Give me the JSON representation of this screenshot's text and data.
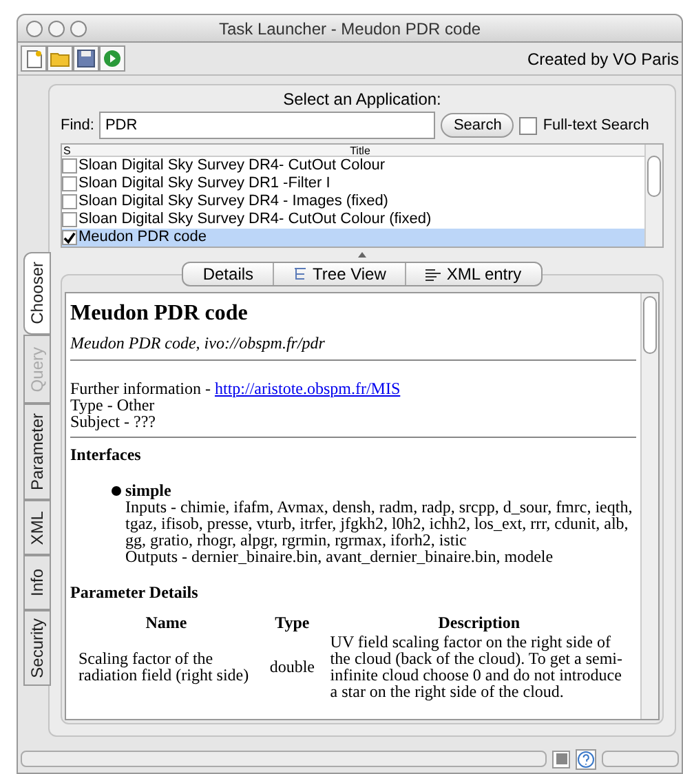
{
  "window": {
    "title": "Task Launcher - Meudon PDR code"
  },
  "credit": "Created by VO Paris",
  "chooser": {
    "heading": "Select an Application:",
    "find_label": "Find:",
    "find_value": "PDR",
    "search_button": "Search",
    "full_text": {
      "label": "Full-text Search",
      "checked": false
    }
  },
  "table": {
    "columns": [
      "S",
      "Title"
    ],
    "rows": [
      {
        "title": "Sloan Digital Sky Survey DR4- CutOut Colour",
        "checked": false,
        "selected": false
      },
      {
        "title": "Sloan Digital Sky Survey DR1 -Filter I",
        "checked": false,
        "selected": false
      },
      {
        "title": "Sloan Digital Sky Survey DR4 - Images (fixed)",
        "checked": false,
        "selected": false
      },
      {
        "title": "Sloan Digital Sky Survey DR4- CutOut Colour (fixed)",
        "checked": false,
        "selected": false
      },
      {
        "title": "Meudon PDR code",
        "checked": true,
        "selected": true
      }
    ]
  },
  "detail_tabs": [
    {
      "label": "Details",
      "kind": "plain"
    },
    {
      "label": "Tree View",
      "kind": "tree"
    },
    {
      "label": "XML entry",
      "kind": "xml"
    }
  ],
  "side_tabs": [
    {
      "label": "Chooser",
      "selected": true,
      "disabled": false
    },
    {
      "label": "Query",
      "selected": false,
      "disabled": true
    },
    {
      "label": "Parameter",
      "selected": false,
      "disabled": false
    },
    {
      "label": "XML",
      "selected": false,
      "disabled": false
    },
    {
      "label": "Info",
      "selected": false,
      "disabled": false
    },
    {
      "label": "Security",
      "selected": false,
      "disabled": false
    }
  ],
  "details": {
    "title": "Meudon PDR code",
    "subtitle": "Meudon PDR code, ivo://obspm.fr/pdr",
    "further_info": "Further information - ",
    "link": "http://aristote.obspm.fr/MIS",
    "type": "Type - Other",
    "subject": "Subject - ???",
    "interfaces_heading": "Interfaces",
    "interface": {
      "name": "simple",
      "inputs": "Inputs - chimie, ifafm, Avmax, densh, radm, radp, srcpp, d_sour, fmrc, ieqth, tgaz, ifisob, presse, vturb, itrfer, jfgkh2, l0h2, ichh2, los_ext, rrr, cdunit, alb, gg, gratio, rhogr, alpgr, rgrmin, rgrmax, iforh2, istic",
      "outputs": "Outputs - dernier_binaire.bin, avant_dernier_binaire.bin, modele"
    },
    "parameters_heading": "Parameter Details",
    "parameters": {
      "columns": [
        "Name",
        "Type",
        "Description"
      ],
      "rows": [
        [
          "Scaling factor of the radiation field (right side)",
          "double",
          "UV field scaling factor on the right side of the cloud (back of the cloud). To get a semi-infinite cloud choose 0 and do not introduce a star on the right side of the cloud."
        ]
      ]
    }
  }
}
